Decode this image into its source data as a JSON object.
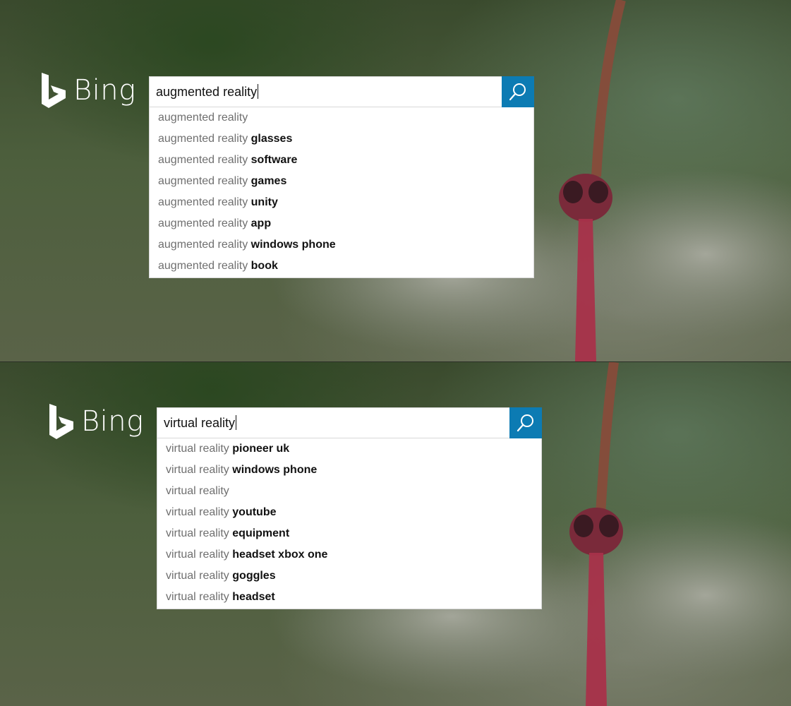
{
  "brand": {
    "name": "Bing",
    "accent": "#0c7bb3"
  },
  "panels": [
    {
      "query": "augmented reality",
      "suggestions": [
        {
          "prefix": "augmented reality",
          "suffix": ""
        },
        {
          "prefix": "augmented reality",
          "suffix": "glasses"
        },
        {
          "prefix": "augmented reality",
          "suffix": "software"
        },
        {
          "prefix": "augmented reality",
          "suffix": "games"
        },
        {
          "prefix": "augmented reality",
          "suffix": "unity"
        },
        {
          "prefix": "augmented reality",
          "suffix": "app"
        },
        {
          "prefix": "augmented reality",
          "suffix": "windows phone"
        },
        {
          "prefix": "augmented reality",
          "suffix": "book"
        }
      ]
    },
    {
      "query": "virtual reality",
      "suggestions": [
        {
          "prefix": "virtual reality",
          "suffix": "pioneer uk"
        },
        {
          "prefix": "virtual reality",
          "suffix": "windows phone"
        },
        {
          "prefix": "virtual reality",
          "suffix": ""
        },
        {
          "prefix": "virtual reality",
          "suffix": "youtube"
        },
        {
          "prefix": "virtual reality",
          "suffix": "equipment"
        },
        {
          "prefix": "virtual reality",
          "suffix": "headset xbox one"
        },
        {
          "prefix": "virtual reality",
          "suffix": "goggles"
        },
        {
          "prefix": "virtual reality",
          "suffix": "headset"
        }
      ]
    }
  ],
  "icons": {
    "logo": "bing-logo-icon",
    "search": "search-icon"
  }
}
